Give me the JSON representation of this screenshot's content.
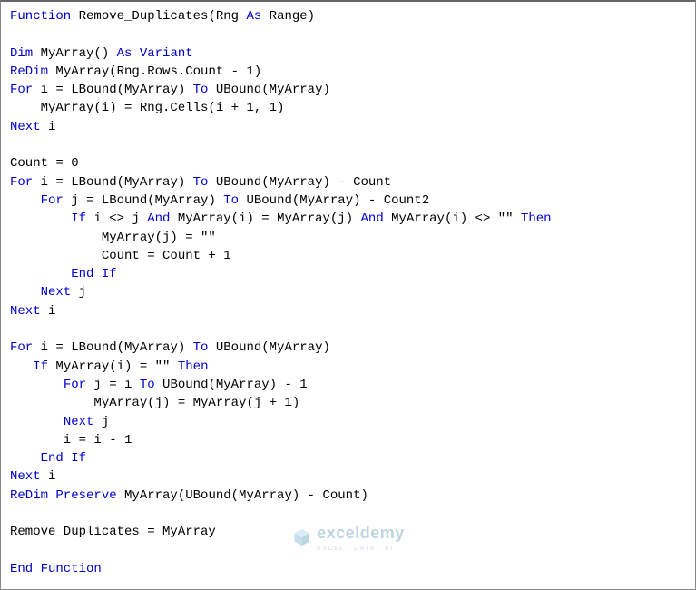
{
  "code": {
    "tokens": [
      [
        [
          "Function",
          "kw"
        ],
        [
          " Remove_Duplicates(Rng ",
          "txt"
        ],
        [
          "As",
          "kw"
        ],
        [
          " Range)",
          "txt"
        ]
      ],
      [],
      [
        [
          "Dim",
          "kw"
        ],
        [
          " MyArray() ",
          "txt"
        ],
        [
          "As Variant",
          "kw"
        ]
      ],
      [
        [
          "ReDim",
          "kw"
        ],
        [
          " MyArray(Rng.Rows.Count - 1)",
          "txt"
        ]
      ],
      [
        [
          "For",
          "kw"
        ],
        [
          " i = LBound(MyArray) ",
          "txt"
        ],
        [
          "To",
          "kw"
        ],
        [
          " UBound(MyArray)",
          "txt"
        ]
      ],
      [
        [
          "    MyArray(i) = Rng.Cells(i + 1, 1)",
          "txt"
        ]
      ],
      [
        [
          "Next",
          "kw"
        ],
        [
          " i",
          "txt"
        ]
      ],
      [],
      [
        [
          "Count = 0",
          "txt"
        ]
      ],
      [
        [
          "For",
          "kw"
        ],
        [
          " i = LBound(MyArray) ",
          "txt"
        ],
        [
          "To",
          "kw"
        ],
        [
          " UBound(MyArray) - Count",
          "txt"
        ]
      ],
      [
        [
          "    ",
          "txt"
        ],
        [
          "For",
          "kw"
        ],
        [
          " j = LBound(MyArray) ",
          "txt"
        ],
        [
          "To",
          "kw"
        ],
        [
          " UBound(MyArray) - Count2",
          "txt"
        ]
      ],
      [
        [
          "        ",
          "txt"
        ],
        [
          "If",
          "kw"
        ],
        [
          " i <> j ",
          "txt"
        ],
        [
          "And",
          "kw"
        ],
        [
          " MyArray(i) = MyArray(j) ",
          "txt"
        ],
        [
          "And",
          "kw"
        ],
        [
          " MyArray(i) <> \"\" ",
          "txt"
        ],
        [
          "Then",
          "kw"
        ]
      ],
      [
        [
          "            MyArray(j) = \"\"",
          "txt"
        ]
      ],
      [
        [
          "            Count = Count + 1",
          "txt"
        ]
      ],
      [
        [
          "        ",
          "txt"
        ],
        [
          "End If",
          "kw"
        ]
      ],
      [
        [
          "    ",
          "txt"
        ],
        [
          "Next",
          "kw"
        ],
        [
          " j",
          "txt"
        ]
      ],
      [
        [
          "Next",
          "kw"
        ],
        [
          " i",
          "txt"
        ]
      ],
      [],
      [
        [
          "For",
          "kw"
        ],
        [
          " i = LBound(MyArray) ",
          "txt"
        ],
        [
          "To",
          "kw"
        ],
        [
          " UBound(MyArray)",
          "txt"
        ]
      ],
      [
        [
          "   ",
          "txt"
        ],
        [
          "If",
          "kw"
        ],
        [
          " MyArray(i) = \"\" ",
          "txt"
        ],
        [
          "Then",
          "kw"
        ]
      ],
      [
        [
          "       ",
          "txt"
        ],
        [
          "For",
          "kw"
        ],
        [
          " j = i ",
          "txt"
        ],
        [
          "To",
          "kw"
        ],
        [
          " UBound(MyArray) - 1",
          "txt"
        ]
      ],
      [
        [
          "           MyArray(j) = MyArray(j + 1)",
          "txt"
        ]
      ],
      [
        [
          "       ",
          "txt"
        ],
        [
          "Next",
          "kw"
        ],
        [
          " j",
          "txt"
        ]
      ],
      [
        [
          "       i = i - 1",
          "txt"
        ]
      ],
      [
        [
          "    ",
          "txt"
        ],
        [
          "End If",
          "kw"
        ]
      ],
      [
        [
          "Next",
          "kw"
        ],
        [
          " i",
          "txt"
        ]
      ],
      [
        [
          "ReDim Preserve",
          "kw"
        ],
        [
          " MyArray(UBound(MyArray) - Count)",
          "txt"
        ]
      ],
      [],
      [
        [
          "Remove_Duplicates = MyArray",
          "txt"
        ]
      ],
      [],
      [
        [
          "End Function",
          "kw"
        ]
      ]
    ]
  },
  "watermark": {
    "main": "exceldemy",
    "sub": "EXCEL · DATA · BI"
  }
}
